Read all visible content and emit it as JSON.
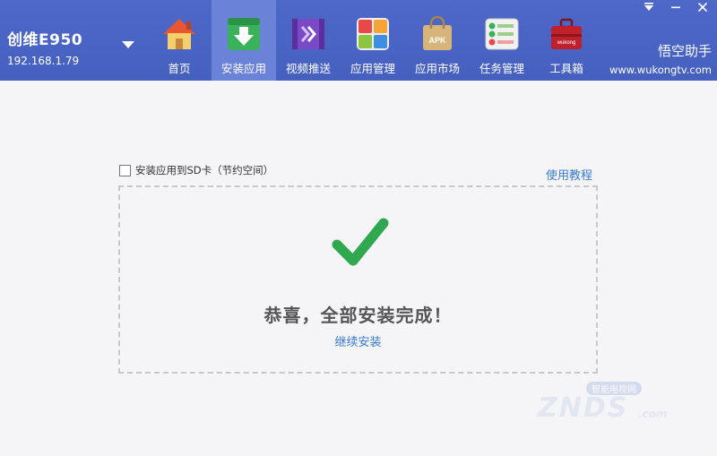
{
  "device": {
    "name": "创维E950",
    "ip": "192.168.1.79"
  },
  "nav": [
    {
      "id": "home",
      "label": "首页",
      "icon": "home-icon"
    },
    {
      "id": "install",
      "label": "安装应用",
      "icon": "install-icon",
      "active": true
    },
    {
      "id": "video",
      "label": "视频推送",
      "icon": "video-push-icon"
    },
    {
      "id": "manage",
      "label": "应用管理",
      "icon": "app-manage-icon"
    },
    {
      "id": "market",
      "label": "应用市场",
      "icon": "apk-market-icon",
      "icon_text": "APK"
    },
    {
      "id": "tasks",
      "label": "任务管理",
      "icon": "task-manage-icon"
    },
    {
      "id": "tools",
      "label": "工具箱",
      "icon": "toolbox-icon",
      "icon_text": "wukong"
    }
  ],
  "brand": {
    "name": "悟空助手",
    "url": "www.wukongtv.com"
  },
  "install": {
    "sd_card_label": "安装应用到SD卡（节约空间）",
    "tutorial_label": "使用教程",
    "success_message": "恭喜，全部安装完成！",
    "continue_label": "继续安装"
  },
  "watermark": {
    "sub": "智能电视网",
    "main": "ZNDS",
    "domain": ".com"
  },
  "colors": {
    "topbar": "#4660c0",
    "active_tab": "#6a82d8",
    "link": "#3a7ad0",
    "check": "#2fa84f"
  }
}
